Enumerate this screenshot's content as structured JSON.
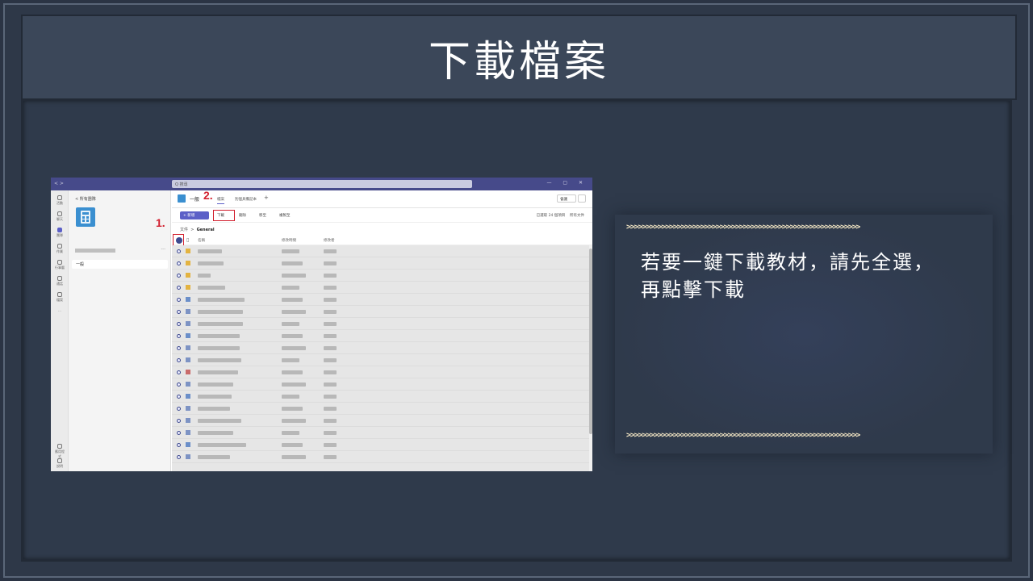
{
  "slide": {
    "title": "下載檔案",
    "instruction_line1": "若要一鍵下載教材，請先全選，",
    "instruction_line2": "再點擊下載",
    "arrow_divider": ">>>>>>>>>>>>>>>>>>>>>>>>>>>>>>>>>>>>>>>>>>>>>>>>>>>>>>>>>>>>",
    "accent_color": "#d2202f"
  },
  "screenshot": {
    "search_placeholder": "Q 搜尋",
    "window_controls": "— ▢ ✕",
    "nav_arrows": "< >",
    "back_link": "< 所有團隊",
    "channel_item": "一般",
    "channel_header": {
      "name": "一般",
      "tabs": [
        "檔案",
        "別個具備記本",
        "+"
      ],
      "meet_label": "會議"
    },
    "toolbar": {
      "new_label": "+ 新增",
      "download_label": "下載",
      "delete_label": "刪除",
      "move_label": "移至",
      "copy_label": "複製至",
      "selected_label": "已選取 24 個項目",
      "all_docs_label": "所有文件"
    },
    "breadcrumb": {
      "root": "文件",
      "current": "General"
    },
    "columns": [
      "名稱",
      "修改時間",
      "修改者"
    ],
    "markers": {
      "step1": "1.",
      "step2": "2."
    },
    "rail_items": [
      "活動",
      "聊天",
      "團隊",
      "作業",
      "行事曆",
      "通話",
      "檔案",
      "...",
      "應用程式",
      "說明"
    ]
  }
}
